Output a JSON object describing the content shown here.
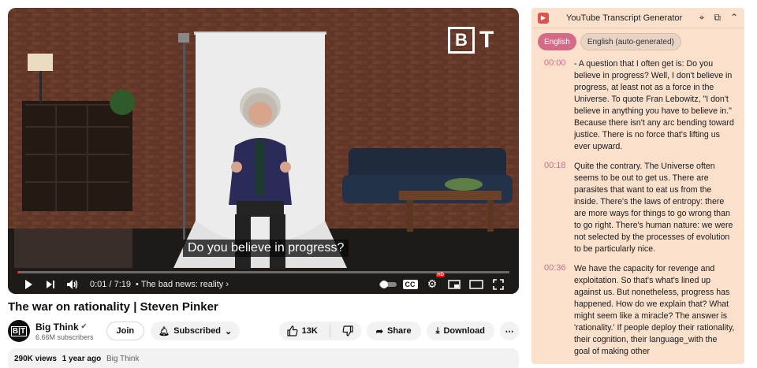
{
  "video": {
    "subtitle": "Do you believe in progress?",
    "time": "0:01 / 7:19",
    "chapter": "The bad news: reality",
    "progress_fraction": 0.002,
    "logo_letters": "B T"
  },
  "icons": {
    "play": "play-icon",
    "next": "next-icon",
    "volume": "volume-icon",
    "cc": "CC",
    "hd": "HD",
    "settings": "gear-icon",
    "miniplayer": "miniplayer-icon",
    "theater": "theater-icon",
    "fullscreen": "fullscreen-icon"
  },
  "meta": {
    "title": "The war on rationality | Steven Pinker",
    "channel": "Big Think",
    "subscribers": "6.66M subscribers",
    "join": "Join",
    "subscribed": "Subscribed",
    "likes": "13K",
    "share": "Share",
    "download": "Download",
    "views": "290K views",
    "age": "1 year ago",
    "channel_tag": "Big Think"
  },
  "panel": {
    "title": "YouTube Transcript Generator",
    "languages": [
      {
        "label": "English",
        "active": true
      },
      {
        "label": "English (auto-generated)",
        "active": false
      }
    ],
    "entries": [
      {
        "time": "00:00",
        "text": "- A question that I often get is: Do you believe in progress? Well, I don't believe in progress, at least not as a force in the Universe. To quote Fran Lebowitz, \"I don't believe in anything you have to believe in.\" Because there isn't any arc bending toward justice. There is no force that's lifting us ever upward."
      },
      {
        "time": "00:18",
        "text": "Quite the contrary. The Universe often seems to be out to get us. There are parasites that want to eat us from the inside. There's the laws of entropy: there are more ways for things to go wrong than to go right. There's human nature: we were not selected by the processes of evolution to be particularly nice."
      },
      {
        "time": "00:36",
        "text": "We have the capacity for revenge and exploitation. So that's what's lined up against us. But nonetheless, progress has happened. How do we explain that? What might seem like a miracle? The answer is 'rationality.' If people deploy their rationality, their cognition, their language_with the goal of making other"
      }
    ]
  },
  "colors": {
    "accent_red": "#ff0000",
    "panel_bg": "#fbe0cc",
    "timestamp": "#c7728a",
    "active_lang": "#d36b88"
  }
}
